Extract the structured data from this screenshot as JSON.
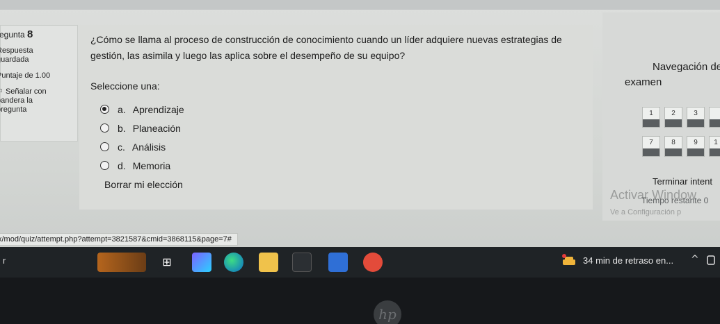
{
  "info": {
    "question_label": "regunta",
    "question_number": "8",
    "status_line1": "Respuesta",
    "status_line2": "guardada",
    "score": "Puntaje de 1.00",
    "flag_line1": "Señalar con",
    "flag_line2": "bandera la",
    "flag_line3": "pregunta"
  },
  "question": {
    "text": "¿Cómo se llama al proceso de construcción de conocimiento cuando un líder adquiere nuevas estrategias de gestión, las asimila y luego las aplica sobre el desempeño de su equipo?",
    "select_one": "Seleccione una:",
    "answers": [
      {
        "letter": "a.",
        "label": "Aprendizaje",
        "checked": true
      },
      {
        "letter": "b.",
        "label": "Planeación",
        "checked": false
      },
      {
        "letter": "c.",
        "label": "Análisis",
        "checked": false
      },
      {
        "letter": "d.",
        "label": "Memoria",
        "checked": false
      }
    ],
    "clear_choice": "Borrar mi elección"
  },
  "navigation": {
    "title_line1": "Navegación der",
    "title_line2": "examen",
    "buttons": [
      "1",
      "2",
      "3",
      "7",
      "8",
      "9",
      "1"
    ],
    "finish": "Terminar intent"
  },
  "overlay": {
    "watermark_line1": "Activar Window",
    "watermark_line2": "Ve a Configuración p",
    "timer": "Tiempo restante 0"
  },
  "statusbar": {
    "url": "x/mod/quiz/attempt.php?attempt=3821587&cmid=3868115&page=7#"
  },
  "taskbar": {
    "search_fragment": "r",
    "notification": "34 min de retraso en...",
    "chevron": "^"
  },
  "brand": "hp"
}
